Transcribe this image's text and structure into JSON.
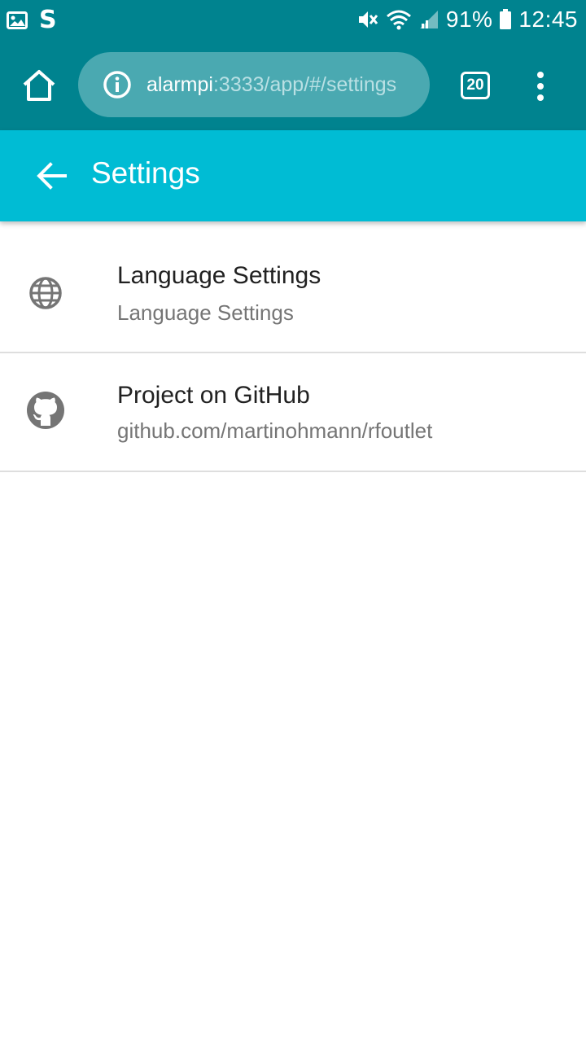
{
  "status_bar": {
    "battery": "91%",
    "time": "12:45",
    "icons": [
      "gallery-icon",
      "s-app-icon",
      "mute-icon",
      "wifi-icon",
      "signal-icon",
      "battery-icon"
    ]
  },
  "browser": {
    "url_host": "alarmpi",
    "url_rest": ":3333/app/#/settings",
    "tab_count": "20",
    "icons": [
      "home-icon",
      "info-icon",
      "overflow-menu-icon"
    ]
  },
  "app_bar": {
    "title": "Settings",
    "icons": [
      "back-arrow-icon"
    ]
  },
  "settings": {
    "items": [
      {
        "icon": "globe-icon",
        "primary": "Language Settings",
        "secondary": "Language Settings"
      },
      {
        "icon": "github-icon",
        "primary": "Project on GitHub",
        "secondary": "github.com/martinohmann/rfoutlet"
      }
    ]
  },
  "colors": {
    "status_bar": "#00838f",
    "browser_bar": "#00838f",
    "url_pill": "#4aa9b1",
    "app_bar": "#00bcd4",
    "icon_grey": "#757575",
    "primary_text": "#212121",
    "secondary_text": "#757575"
  }
}
